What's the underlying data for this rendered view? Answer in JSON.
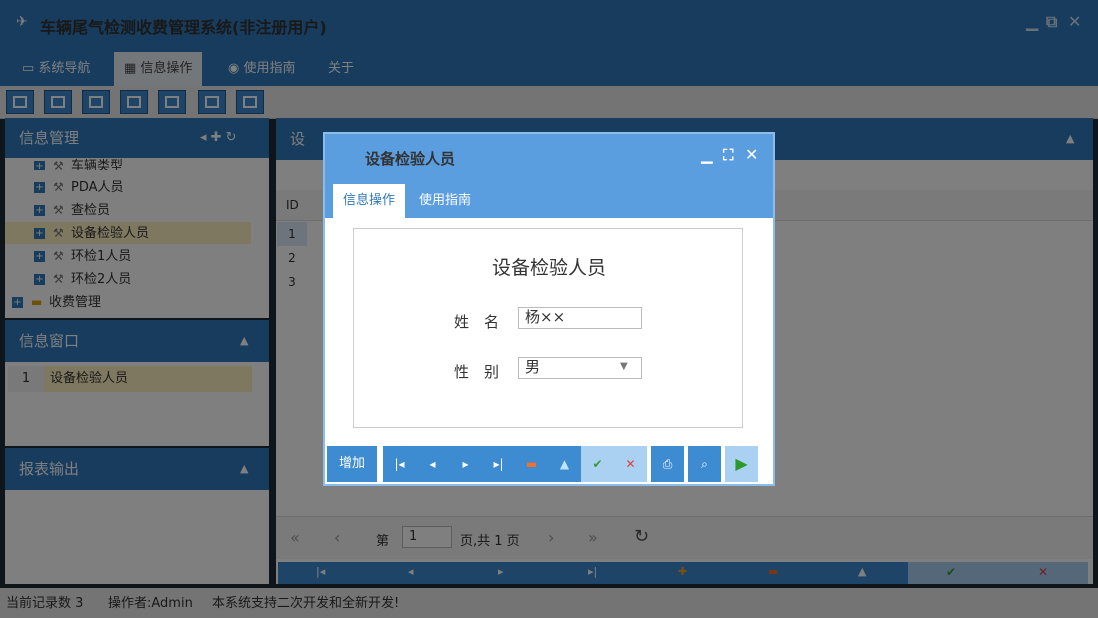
{
  "app": {
    "title": "车辆尾气检测收费管理系统(非注册用户)"
  },
  "menu": {
    "tabs": [
      {
        "label": "系统导航"
      },
      {
        "label": "信息操作"
      },
      {
        "label": "使用指南"
      },
      {
        "label": "关于"
      }
    ]
  },
  "left": {
    "info_manage": {
      "title": "信息管理",
      "items": [
        {
          "label": "车辆类型"
        },
        {
          "label": "PDA人员"
        },
        {
          "label": "查检员"
        },
        {
          "label": "设备检验人员"
        },
        {
          "label": "环检1人员"
        },
        {
          "label": "环检2人员"
        }
      ],
      "folder": "收费管理"
    },
    "info_window": {
      "title": "信息窗口",
      "row_index": "1",
      "row_label": "设备检验人员"
    },
    "report": {
      "title": "报表输出"
    }
  },
  "main": {
    "title": "设",
    "grid": {
      "id_header": "ID",
      "rows": [
        "1",
        "2",
        "3"
      ]
    },
    "pager": {
      "page_prefix": "第",
      "page_value": "1",
      "page_suffix": "页,共 1 页"
    }
  },
  "status": {
    "record_count": "当前记录数 3",
    "operator": "操作者:Admin",
    "message": "本系统支持二次开发和全新开发!"
  },
  "dialog": {
    "title": "设备检验人员",
    "tabs": [
      {
        "label": "信息操作"
      },
      {
        "label": "使用指南"
      }
    ],
    "form": {
      "heading": "设备检验人员",
      "name_label": "姓　名",
      "name_value": "杨××",
      "gender_label": "性　别",
      "gender_value": "男"
    },
    "buttons": {
      "add": "增加"
    }
  },
  "colors": {
    "primary": "#2f79bd",
    "dialog_header": "#5b9ee0",
    "button_blue": "#3d8bd1",
    "button_light": "#aad0f2"
  }
}
